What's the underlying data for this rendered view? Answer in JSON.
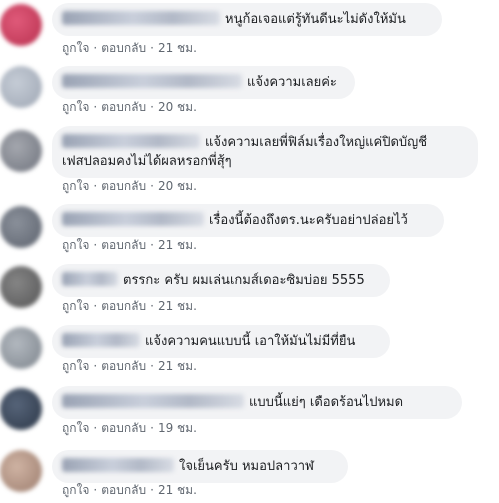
{
  "actions": {
    "like_label": "ถูกใจ",
    "reply_label": "ตอบกลับ",
    "separator": "·"
  },
  "comments": [
    {
      "name": "",
      "text": "หนูก้อเจอแต่รู้ทันดีนะไม่ดังให้มัน",
      "time": "21 ชม.",
      "avatar_color": "#d84a6b"
    },
    {
      "name": "",
      "text": "แจ้งความเลยค่ะ",
      "time": "20 ชม.",
      "avatar_color": "#b4bcc8"
    },
    {
      "name": "",
      "text_line1": "แจ้งความเลยพี่ฟิล์มเรื่องใหญ่แค่ปิดบัญชี",
      "text_line2": "เฟสปลอมคงไม่ได้ผลหรอกพี่สุ้ๆ",
      "time": "20 ชม.",
      "avatar_color": "#8c8f98"
    },
    {
      "name": "",
      "text": "เรื่องนี้ต้องถึงตร.นะครับอย่าปล่อยไว้",
      "time": "21 ชม.",
      "avatar_color": "#707784"
    },
    {
      "name": "",
      "text": "ตรรกะ ครับ ผมเล่นเกมส์เดอะซิมบ่อย 5555",
      "time": "21 ชม.",
      "avatar_color": "#6f6f70"
    },
    {
      "name": "",
      "text": "แจ้งความคนแบบนี้ เอาให้มันไม่มีที่ยืน",
      "time": "21 ชม.",
      "avatar_color": "#9aa1a8"
    },
    {
      "name": "",
      "text": "แบบนี้แย่ๆ เดือดร้อนไปหมด",
      "time": "19 ชม.",
      "avatar_color": "#3f4c5e"
    },
    {
      "name": "",
      "text": "ใจเย็นครับ หมอปลาวาฬ",
      "time": "21 ชม.",
      "avatar_color": "#b89a8a"
    }
  ]
}
